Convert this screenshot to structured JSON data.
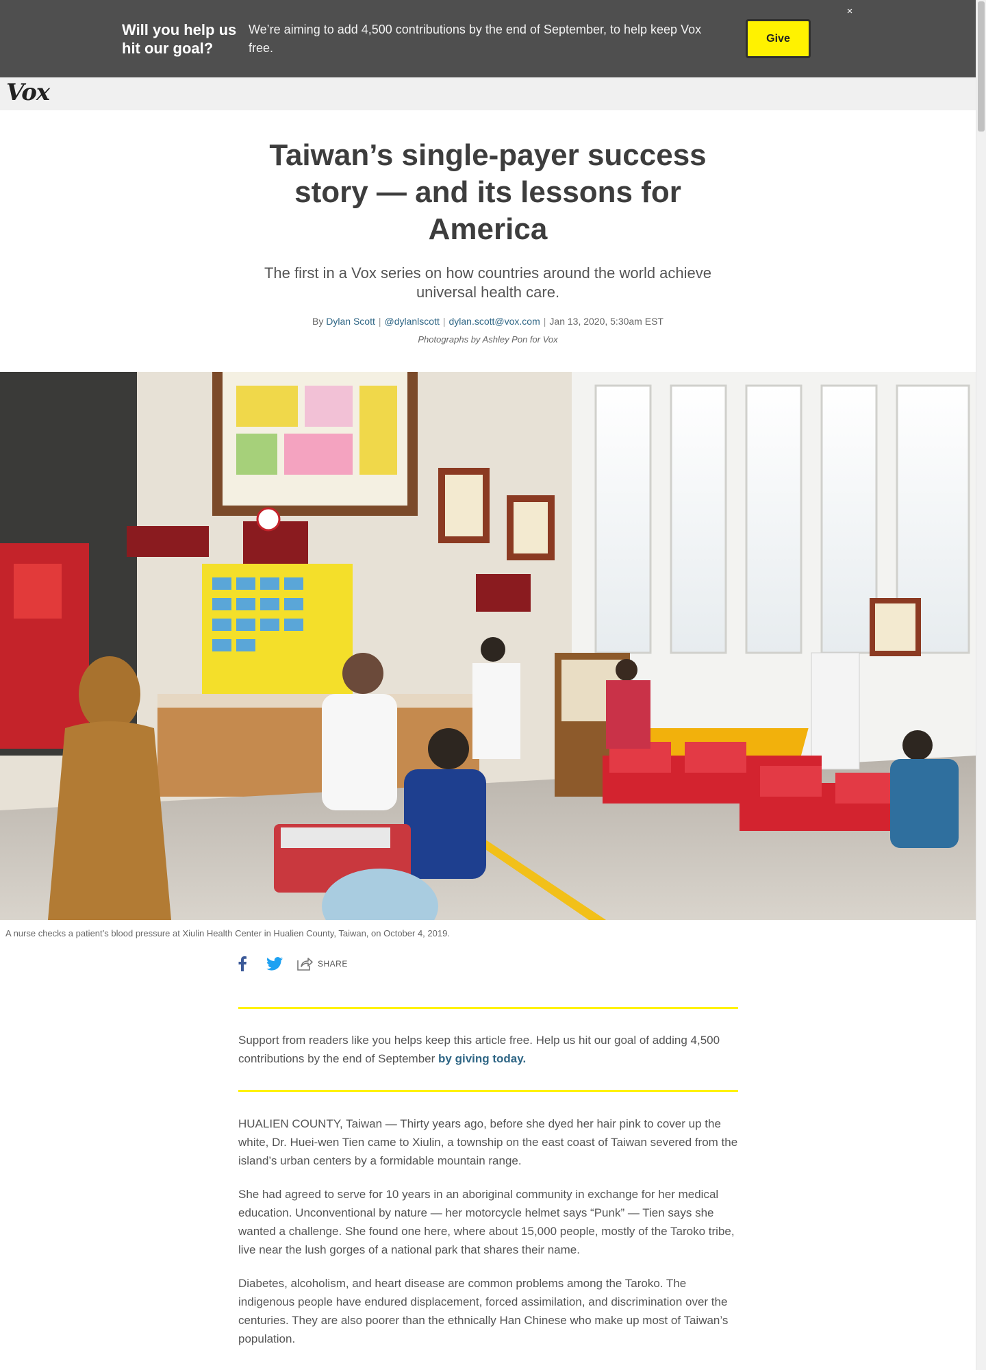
{
  "banner": {
    "title": "Will you help us hit our goal?",
    "text": "We’re aiming to add 4,500 contributions by the end of September, to help keep Vox free.",
    "give_label": "Give",
    "close_glyph": "×"
  },
  "header": {
    "logo": "Vox"
  },
  "article": {
    "headline": "Taiwan’s single-payer success story — and its lessons for America",
    "dek": "The first in a Vox series on how countries around the world achieve universal health care.",
    "byline": {
      "by": "By",
      "author": "Dylan Scott",
      "twitter": "@dylanlscott",
      "email": "dylan.scott@vox.com",
      "date": "Jan 13, 2020, 5:30am EST"
    },
    "photo_credit": "Photographs by Ashley Pon for Vox",
    "hero_caption": "A nurse checks a patient’s blood pressure at Xiulin Health Center in Hualien County, Taiwan, on October 4, 2019.",
    "share_label": "SHARE",
    "support": {
      "text": "Support from readers like you helps keep this article free. Help us hit our goal of adding 4,500 contributions by the end of September",
      "link": "by giving today."
    },
    "paragraphs": [
      "HUALIEN COUNTY, Taiwan — Thirty years ago, before she dyed her hair pink to cover up the white, Dr. Huei-wen Tien came to Xiulin, a township on the east coast of Taiwan severed from the island’s urban centers by a formidable mountain range.",
      "She had agreed to serve for 10 years in an aboriginal community in exchange for her medical education. Unconventional by nature — her motorcycle helmet says “Punk” — Tien says she wanted a challenge. She found one here, where about 15,000 people, mostly of the Taroko tribe, live near the lush gorges of a national park that shares their name.",
      "Diabetes, alcoholism, and heart disease are common problems among the Taroko. The indigenous people have endured displacement, forced assimilation, and discrimination over the centuries. They are also poorer than the ethnically Han Chinese who make up most of Taiwan’s population."
    ]
  },
  "icons": {
    "facebook": "facebook-icon",
    "twitter": "twitter-icon",
    "share": "share-icon"
  },
  "colors": {
    "banner_bg": "#4f4f4f",
    "give_button": "#fff200",
    "link": "#2f6685",
    "support_rule": "#fff200",
    "facebook": "#3b5998",
    "twitter": "#1da1f2"
  }
}
